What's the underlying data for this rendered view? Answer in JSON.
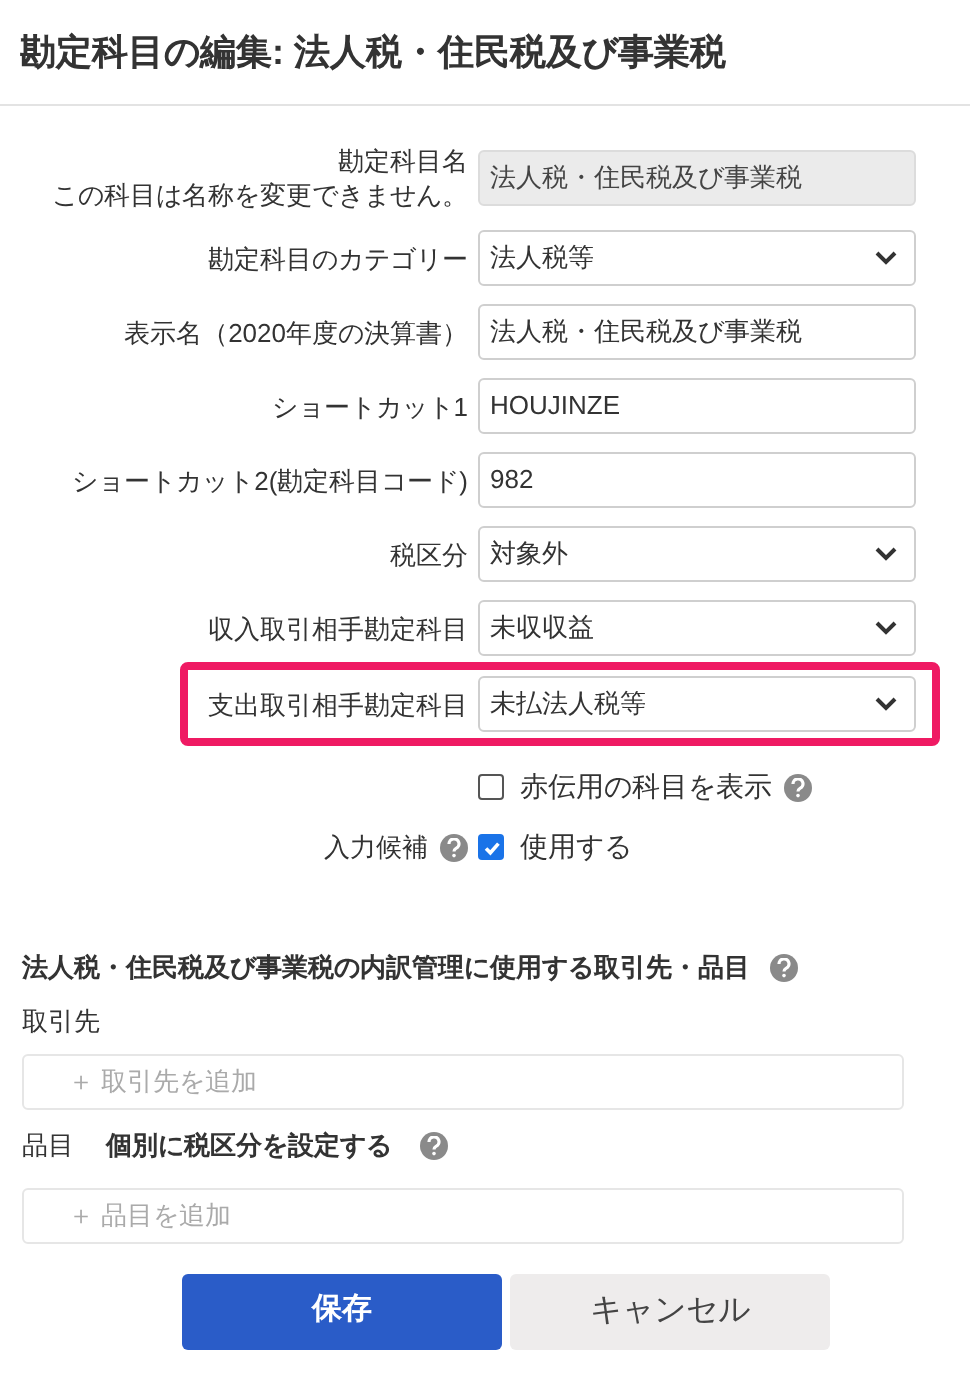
{
  "title": "勘定科目の編集: 法人税・住民税及び事業税",
  "fields": [
    {
      "label": "勘定科目名",
      "note": "この科目は名称を変更できません。",
      "kind": "readonly",
      "value": "法人税・住民税及び事業税",
      "highlighted": false
    },
    {
      "label": "勘定科目のカテゴリー",
      "kind": "select",
      "value": "法人税等",
      "highlighted": false
    },
    {
      "label": "表示名（2020年度の決算書）",
      "kind": "text",
      "value": "法人税・住民税及び事業税",
      "highlighted": false
    },
    {
      "label": "ショートカット1",
      "kind": "text",
      "value": "HOUJINZE",
      "highlighted": false
    },
    {
      "label": "ショートカット2(勘定科目コード)",
      "kind": "text",
      "value": "982",
      "highlighted": false
    },
    {
      "label": "税区分",
      "kind": "select",
      "value": "対象外",
      "highlighted": false
    },
    {
      "label": "収入取引相手勘定科目",
      "kind": "select",
      "value": "未収収益",
      "highlighted": false
    },
    {
      "label": "支出取引相手勘定科目",
      "kind": "select",
      "value": "未払法人税等",
      "highlighted": true
    }
  ],
  "checkboxes": [
    {
      "kind": "plain",
      "text": "赤伝用の科目を表示",
      "checked": false,
      "help": true
    },
    {
      "kind": "labeled",
      "label": "入力候補",
      "text": "使用する",
      "checked": true,
      "help": true
    }
  ],
  "breakdown": {
    "heading": "法人税・住民税及び事業税の内訳管理に使用する取引先・品目",
    "partner_label": "取引先",
    "partner_placeholder": "＋ 取引先を追加",
    "item_label": "品目",
    "item_option": "個別に税区分を設定する",
    "item_placeholder": "＋ 品目を追加"
  },
  "buttons": {
    "save": "保存",
    "cancel": "キャンセル"
  }
}
